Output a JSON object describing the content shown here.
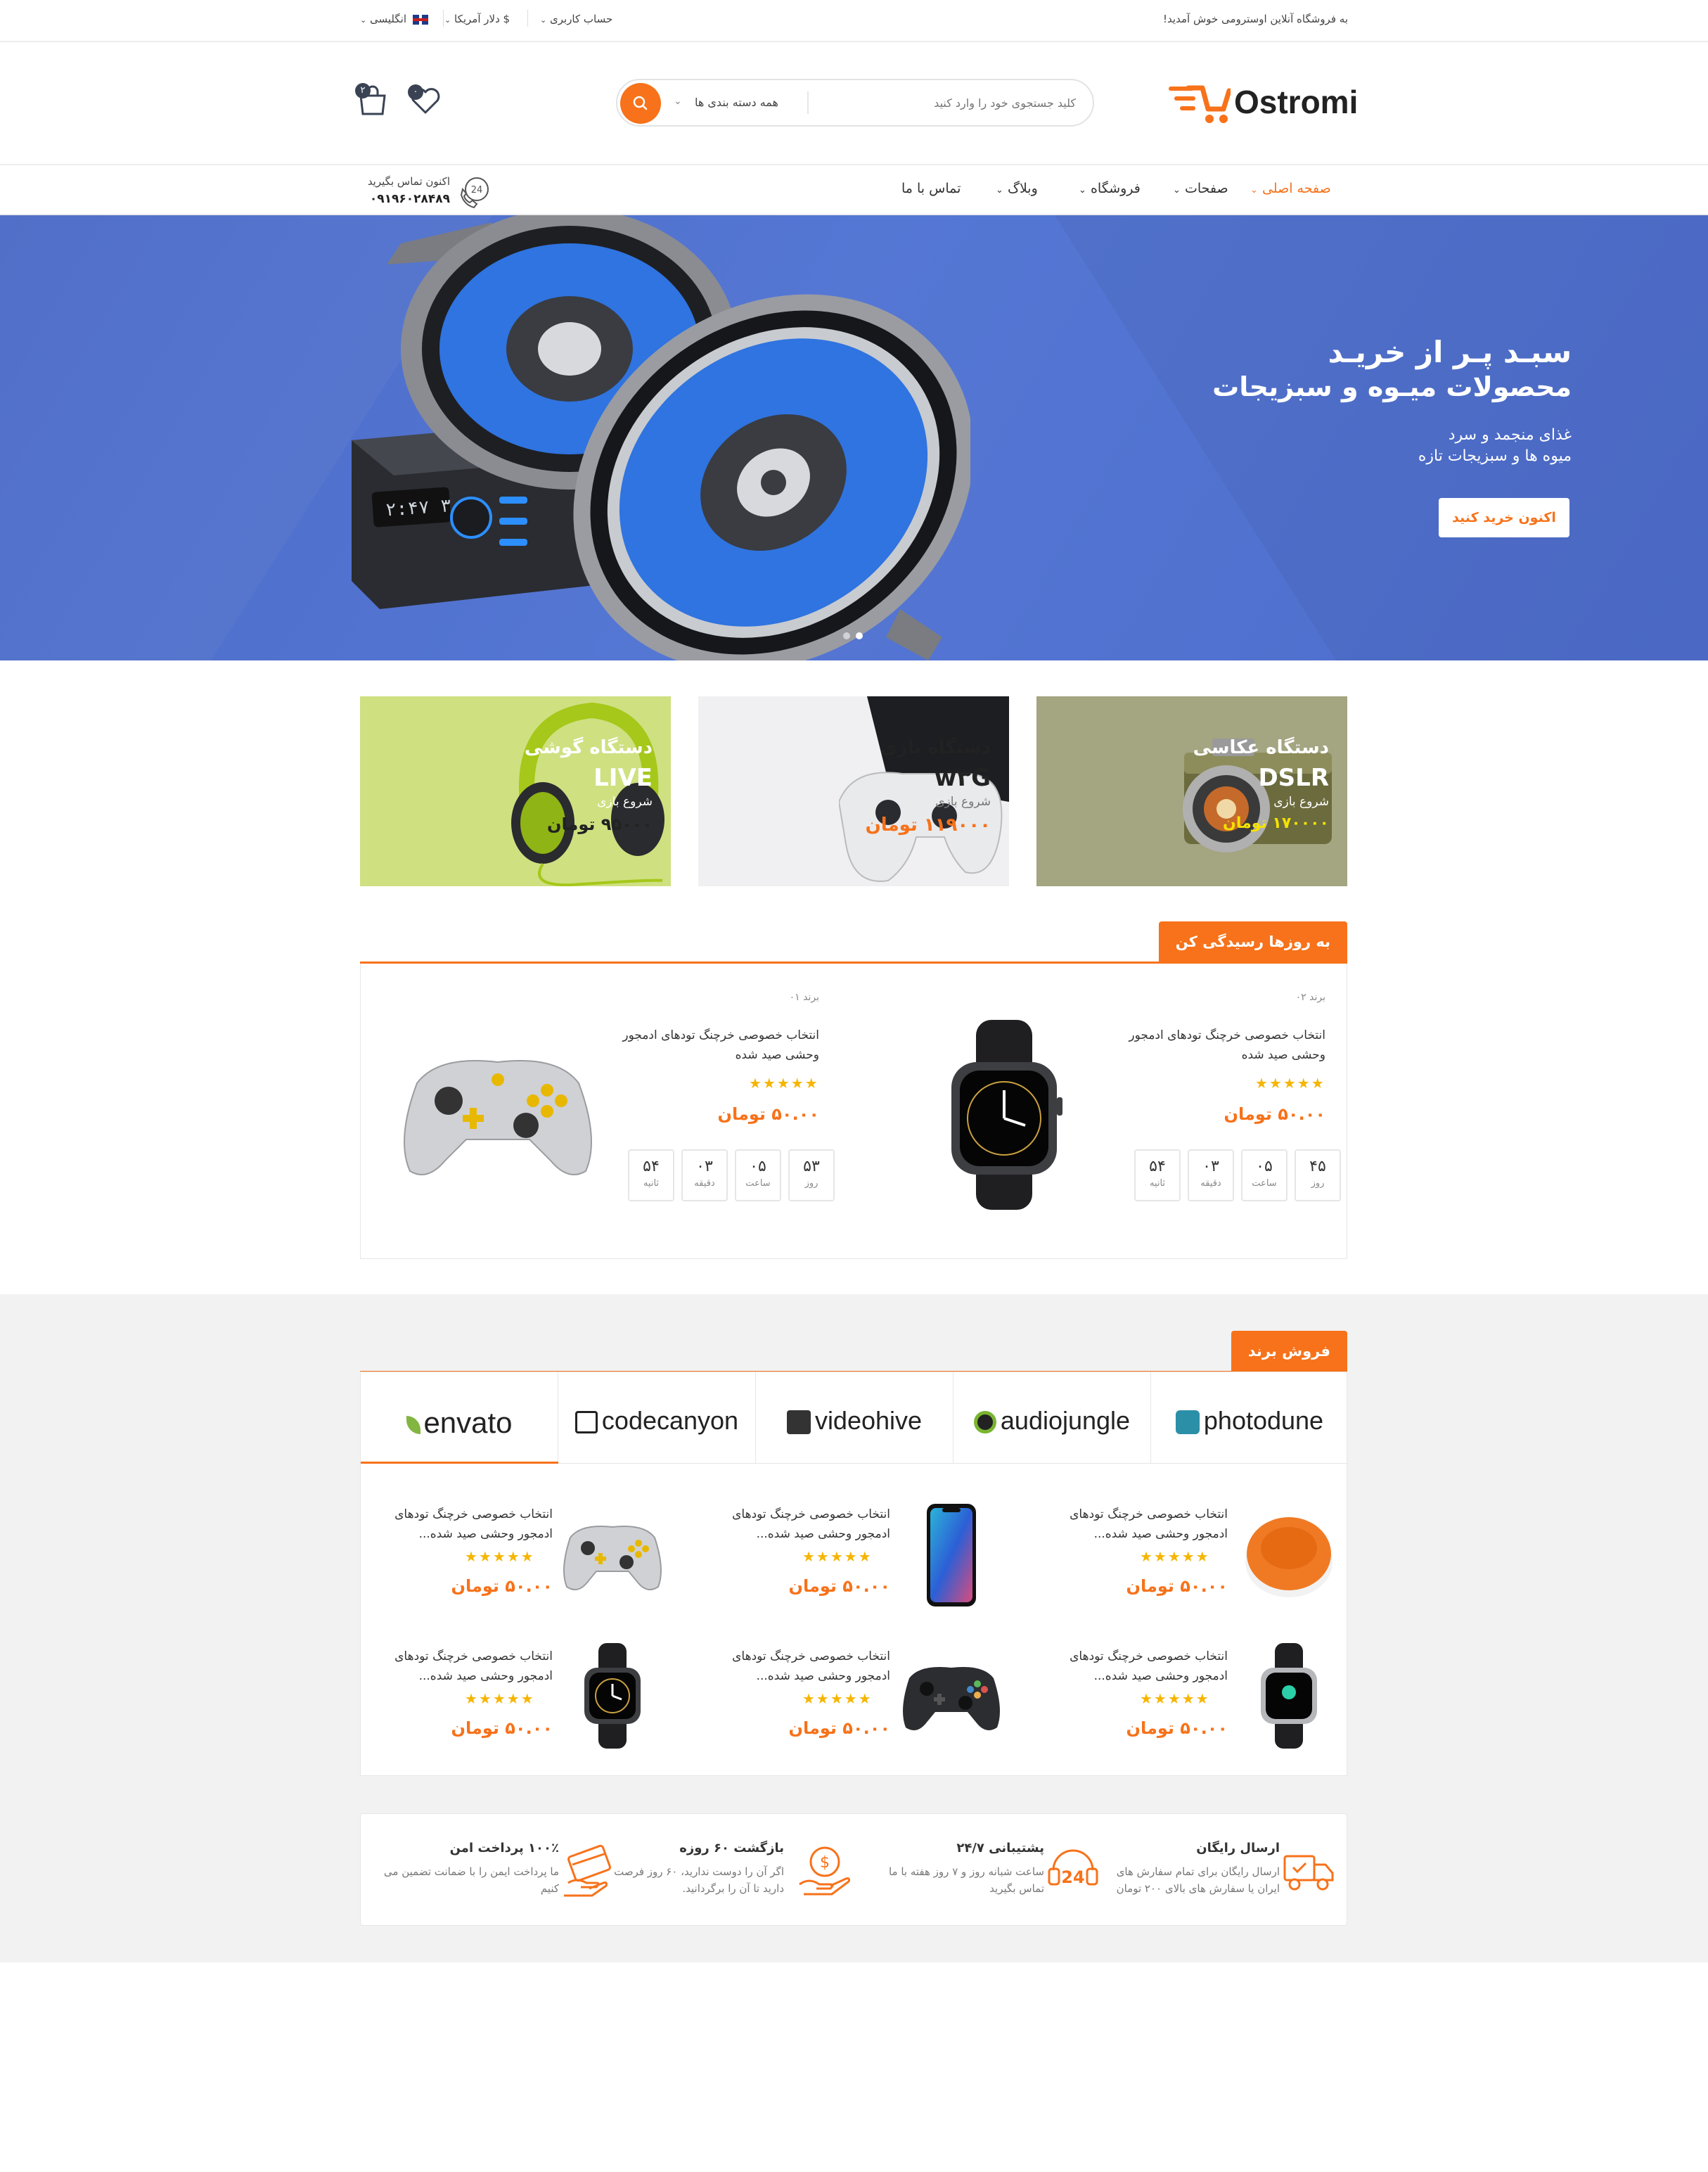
{
  "topbar": {
    "welcome": "به فروشگاه آنلاین اوسترومی خوش آمدید!",
    "account": "حساب کاربری",
    "currency": "$ دلار آمریکا",
    "language": "انگلیسی"
  },
  "header": {
    "logo": "Ostromi",
    "search_placeholder": "کلید جستجوی خود را وارد کنید",
    "search_category": "همه دسته بندی ها",
    "cart_count": "۲",
    "wishlist_count": "۰"
  },
  "nav": {
    "items": [
      "صفحه اصلی",
      "صفحات",
      "فروشگاه",
      "وبلاگ",
      "تماس با ما"
    ],
    "contact_label": "اکنون تماس بگیرید",
    "contact_phone": "۰۹۱۹۶۰۲۸۴۸۹",
    "phone_icon_text": "24"
  },
  "hero": {
    "title1": "سبـد پـر از خریـد",
    "title2": "محصولات میـوه و سبزیجات",
    "sub1": "غذای منجمد و سرد",
    "sub2": "میوه ها و سبزیجات تازه",
    "button": "اکنون خرید کنید",
    "display_text": "۲:۴۷ ۳۰"
  },
  "banners": [
    {
      "title": "دستگاه عکاسی",
      "model": "DSLR",
      "start": "شروع بازی",
      "price": "۱۷۰۰۰۰ تومان",
      "color": "#a4a581"
    },
    {
      "title": "دستگاه بازی",
      "model": "w۳G",
      "start": "شروع بازی",
      "price": "۱۱۹۰۰۰ تومان",
      "color": "#f0f0f2"
    },
    {
      "title": "دستگاه گوشی",
      "model": "LIVE",
      "start": "شروع بازی",
      "price": "۹۵۰۰۰ تومان",
      "color": "#cfe081"
    }
  ],
  "deals": {
    "heading": "به روزها رسیدگی کن",
    "items": [
      {
        "brand": "برند ۰۲",
        "name": "انتخاب خصوصی خرچنگ تودهای ادمجور وحشی صید شده",
        "rating": 5,
        "price": "۵۰.۰۰ تومان",
        "countdown": [
          {
            "n": "۴۵",
            "l": "روز"
          },
          {
            "n": "۰۵",
            "l": "ساعت"
          },
          {
            "n": "۰۳",
            "l": "دقیقه"
          },
          {
            "n": "۵۴",
            "l": "ثانیه"
          }
        ]
      },
      {
        "brand": "برند ۰۱",
        "name": "انتخاب خصوصی خرچنگ تودهای ادمجور وحشی صید شده",
        "rating": 5,
        "price": "۵۰.۰۰ تومان",
        "countdown": [
          {
            "n": "۵۳",
            "l": "روز"
          },
          {
            "n": "۰۵",
            "l": "ساعت"
          },
          {
            "n": "۰۳",
            "l": "دقیقه"
          },
          {
            "n": "۵۴",
            "l": "ثانیه"
          }
        ]
      }
    ]
  },
  "brands": {
    "heading": "فروش برند",
    "tabs": [
      "photodune",
      "audiojungle",
      "videohive",
      "codecanyon",
      "envato"
    ],
    "products": [
      {
        "name": "انتخاب خصوصی خرچنگ تودهای ادمجور وحشی صید شده...",
        "rating": 5,
        "price": "۵۰.۰۰ تومان",
        "icon": "speaker-icon"
      },
      {
        "name": "انتخاب خصوصی خرچنگ تودهای ادمجور وحشی صید شده...",
        "rating": 5,
        "price": "۵۰.۰۰ تومان",
        "icon": "phone-icon"
      },
      {
        "name": "انتخاب خصوصی خرچنگ تودهای ادمجور وحشی صید شده...",
        "rating": 5,
        "price": "۵۰.۰۰ تومان",
        "icon": "gamepad-icon"
      },
      {
        "name": "انتخاب خصوصی خرچنگ تودهای ادمجور وحشی صید شده...",
        "rating": 5,
        "price": "۵۰.۰۰ تومان",
        "icon": "watch-icon"
      },
      {
        "name": "انتخاب خصوصی خرچنگ تودهای ادمجور وحشی صید شده...",
        "rating": 5,
        "price": "۵۰.۰۰ تومان",
        "icon": "gamepad-icon"
      },
      {
        "name": "انتخاب خصوصی خرچنگ تودهای ادمجور وحشی صید شده...",
        "rating": 5,
        "price": "۵۰.۰۰ تومان",
        "icon": "watch-icon"
      }
    ]
  },
  "features": [
    {
      "title": "ارسال رایگان",
      "desc": "ارسال رایگان برای تمام سفارش های ایران یا سفارش های بالای ۲۰۰ تومان",
      "icon": "truck-icon"
    },
    {
      "title": "پشتیبانی ۲۴/۷",
      "desc": "ساعت شبانه روز و ۷ روز هفته با ما تماس بگیرید",
      "icon": "support-24-icon"
    },
    {
      "title": "بازگشت ۶۰ روزه",
      "desc": "اگر آن را دوست ندارید، ۶۰ روز فرصت دارید تا آن را برگردانید.",
      "icon": "money-back-icon"
    },
    {
      "title": "۱۰۰٪ پرداخت امن",
      "desc": "ما پرداخت ایمن را با ضمانت تضمین می کنیم",
      "icon": "credit-card-icon"
    }
  ],
  "colors": {
    "accent": "#f7721a",
    "hero_bg": "#5073d0",
    "star": "#f6b500"
  }
}
